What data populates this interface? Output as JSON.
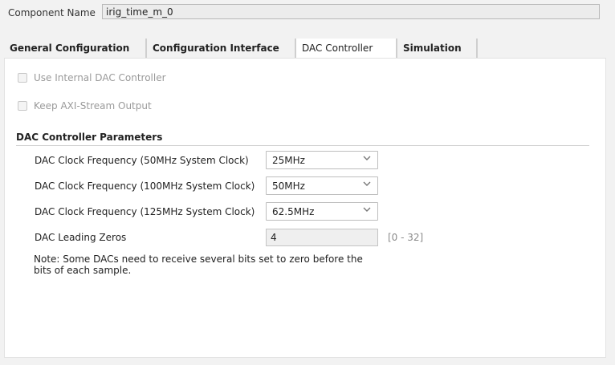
{
  "component": {
    "label": "Component Name",
    "value": "irig_time_m_0"
  },
  "tabs": [
    {
      "label": "General Configuration"
    },
    {
      "label": "Configuration Interface"
    },
    {
      "label": "DAC Controller"
    },
    {
      "label": "Simulation"
    }
  ],
  "options": {
    "internal_dac": "Use Internal DAC Controller",
    "keep_axi": "Keep AXI-Stream Output"
  },
  "section": {
    "title": "DAC Controller Parameters"
  },
  "params": [
    {
      "label": "DAC Clock Frequency (50MHz System Clock)",
      "value": "25MHz"
    },
    {
      "label": "DAC Clock Frequency (100MHz System Clock)",
      "value": "50MHz"
    },
    {
      "label": "DAC Clock Frequency (125MHz System Clock)",
      "value": "62.5MHz"
    }
  ],
  "leading_zeros": {
    "label": "DAC Leading Zeros",
    "value": "4",
    "range": "[0 - 32]"
  },
  "note": "Note: Some DACs need to receive several bits set to zero before the bits of each sample."
}
